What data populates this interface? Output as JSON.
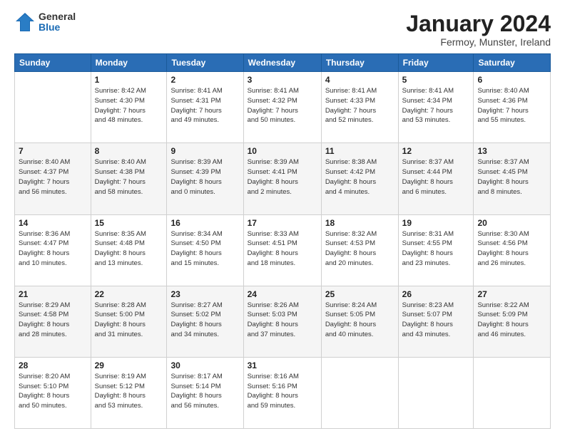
{
  "header": {
    "logo_general": "General",
    "logo_blue": "Blue",
    "month_title": "January 2024",
    "location": "Fermoy, Munster, Ireland"
  },
  "days_of_week": [
    "Sunday",
    "Monday",
    "Tuesday",
    "Wednesday",
    "Thursday",
    "Friday",
    "Saturday"
  ],
  "weeks": [
    [
      {
        "day": "",
        "info": ""
      },
      {
        "day": "1",
        "info": "Sunrise: 8:42 AM\nSunset: 4:30 PM\nDaylight: 7 hours\nand 48 minutes."
      },
      {
        "day": "2",
        "info": "Sunrise: 8:41 AM\nSunset: 4:31 PM\nDaylight: 7 hours\nand 49 minutes."
      },
      {
        "day": "3",
        "info": "Sunrise: 8:41 AM\nSunset: 4:32 PM\nDaylight: 7 hours\nand 50 minutes."
      },
      {
        "day": "4",
        "info": "Sunrise: 8:41 AM\nSunset: 4:33 PM\nDaylight: 7 hours\nand 52 minutes."
      },
      {
        "day": "5",
        "info": "Sunrise: 8:41 AM\nSunset: 4:34 PM\nDaylight: 7 hours\nand 53 minutes."
      },
      {
        "day": "6",
        "info": "Sunrise: 8:40 AM\nSunset: 4:36 PM\nDaylight: 7 hours\nand 55 minutes."
      }
    ],
    [
      {
        "day": "7",
        "info": "Sunrise: 8:40 AM\nSunset: 4:37 PM\nDaylight: 7 hours\nand 56 minutes."
      },
      {
        "day": "8",
        "info": "Sunrise: 8:40 AM\nSunset: 4:38 PM\nDaylight: 7 hours\nand 58 minutes."
      },
      {
        "day": "9",
        "info": "Sunrise: 8:39 AM\nSunset: 4:39 PM\nDaylight: 8 hours\nand 0 minutes."
      },
      {
        "day": "10",
        "info": "Sunrise: 8:39 AM\nSunset: 4:41 PM\nDaylight: 8 hours\nand 2 minutes."
      },
      {
        "day": "11",
        "info": "Sunrise: 8:38 AM\nSunset: 4:42 PM\nDaylight: 8 hours\nand 4 minutes."
      },
      {
        "day": "12",
        "info": "Sunrise: 8:37 AM\nSunset: 4:44 PM\nDaylight: 8 hours\nand 6 minutes."
      },
      {
        "day": "13",
        "info": "Sunrise: 8:37 AM\nSunset: 4:45 PM\nDaylight: 8 hours\nand 8 minutes."
      }
    ],
    [
      {
        "day": "14",
        "info": "Sunrise: 8:36 AM\nSunset: 4:47 PM\nDaylight: 8 hours\nand 10 minutes."
      },
      {
        "day": "15",
        "info": "Sunrise: 8:35 AM\nSunset: 4:48 PM\nDaylight: 8 hours\nand 13 minutes."
      },
      {
        "day": "16",
        "info": "Sunrise: 8:34 AM\nSunset: 4:50 PM\nDaylight: 8 hours\nand 15 minutes."
      },
      {
        "day": "17",
        "info": "Sunrise: 8:33 AM\nSunset: 4:51 PM\nDaylight: 8 hours\nand 18 minutes."
      },
      {
        "day": "18",
        "info": "Sunrise: 8:32 AM\nSunset: 4:53 PM\nDaylight: 8 hours\nand 20 minutes."
      },
      {
        "day": "19",
        "info": "Sunrise: 8:31 AM\nSunset: 4:55 PM\nDaylight: 8 hours\nand 23 minutes."
      },
      {
        "day": "20",
        "info": "Sunrise: 8:30 AM\nSunset: 4:56 PM\nDaylight: 8 hours\nand 26 minutes."
      }
    ],
    [
      {
        "day": "21",
        "info": "Sunrise: 8:29 AM\nSunset: 4:58 PM\nDaylight: 8 hours\nand 28 minutes."
      },
      {
        "day": "22",
        "info": "Sunrise: 8:28 AM\nSunset: 5:00 PM\nDaylight: 8 hours\nand 31 minutes."
      },
      {
        "day": "23",
        "info": "Sunrise: 8:27 AM\nSunset: 5:02 PM\nDaylight: 8 hours\nand 34 minutes."
      },
      {
        "day": "24",
        "info": "Sunrise: 8:26 AM\nSunset: 5:03 PM\nDaylight: 8 hours\nand 37 minutes."
      },
      {
        "day": "25",
        "info": "Sunrise: 8:24 AM\nSunset: 5:05 PM\nDaylight: 8 hours\nand 40 minutes."
      },
      {
        "day": "26",
        "info": "Sunrise: 8:23 AM\nSunset: 5:07 PM\nDaylight: 8 hours\nand 43 minutes."
      },
      {
        "day": "27",
        "info": "Sunrise: 8:22 AM\nSunset: 5:09 PM\nDaylight: 8 hours\nand 46 minutes."
      }
    ],
    [
      {
        "day": "28",
        "info": "Sunrise: 8:20 AM\nSunset: 5:10 PM\nDaylight: 8 hours\nand 50 minutes."
      },
      {
        "day": "29",
        "info": "Sunrise: 8:19 AM\nSunset: 5:12 PM\nDaylight: 8 hours\nand 53 minutes."
      },
      {
        "day": "30",
        "info": "Sunrise: 8:17 AM\nSunset: 5:14 PM\nDaylight: 8 hours\nand 56 minutes."
      },
      {
        "day": "31",
        "info": "Sunrise: 8:16 AM\nSunset: 5:16 PM\nDaylight: 8 hours\nand 59 minutes."
      },
      {
        "day": "",
        "info": ""
      },
      {
        "day": "",
        "info": ""
      },
      {
        "day": "",
        "info": ""
      }
    ]
  ]
}
